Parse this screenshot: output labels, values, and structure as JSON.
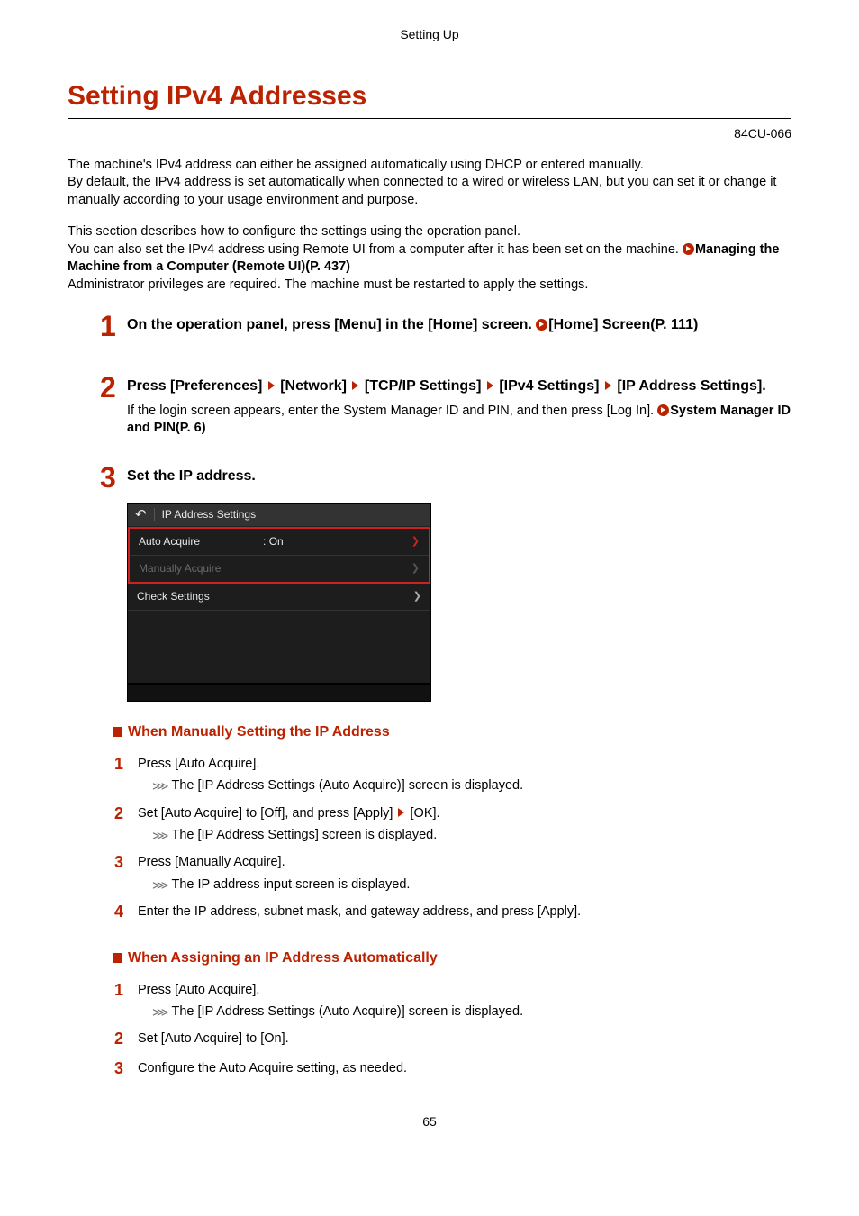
{
  "header": {
    "section": "Setting Up"
  },
  "title": "Setting IPv4 Addresses",
  "doc_code": "84CU-066",
  "intro": {
    "p1_l1": "The machine's IPv4 address can either be assigned automatically using DHCP or entered manually.",
    "p1_l2": "By default, the IPv4 address is set automatically when connected to a wired or wireless LAN, but you can set it or change it manually according to your usage environment and purpose.",
    "p2_l1": "This section describes how to configure the settings using the operation panel.",
    "p2_l2a": "You can also set the IPv4 address using Remote UI from a computer after it has been set on the machine. ",
    "p2_link": "Managing the Machine from a Computer (Remote UI)(P. 437)",
    "p2_l3": "Administrator privileges are required. The machine must be restarted to apply the settings."
  },
  "steps": {
    "s1": {
      "num": "1",
      "title_a": "On the operation panel, press [Menu] in the [Home] screen. ",
      "title_link": "[Home] Screen(P. 111)"
    },
    "s2": {
      "num": "2",
      "bc1": "Press [Preferences]",
      "bc2": "[Network]",
      "bc3": "[TCP/IP Settings]",
      "bc4": "[IPv4 Settings]",
      "bc5": "[IP Address Settings].",
      "desc_a": "If the login screen appears, enter the System Manager ID and PIN, and then press [Log In]. ",
      "desc_link": "System Manager ID and PIN(P. 6)"
    },
    "s3": {
      "num": "3",
      "title": "Set the IP address."
    }
  },
  "device": {
    "title": "IP Address Settings",
    "row1_label": "Auto Acquire",
    "row1_value": ": On",
    "row2_label": "Manually Acquire",
    "row3_label": "Check Settings"
  },
  "sub_a": {
    "heading": "When Manually Setting the IP Address",
    "s1": {
      "num": "1",
      "text": "Press [Auto Acquire].",
      "result": "The [IP Address Settings (Auto Acquire)] screen is displayed."
    },
    "s2": {
      "num": "2",
      "text_a": "Set [Auto Acquire] to [Off], and press [Apply] ",
      "text_b": " [OK].",
      "result": "The [IP Address Settings] screen is displayed."
    },
    "s3": {
      "num": "3",
      "text": "Press [Manually Acquire].",
      "result": "The IP address input screen is displayed."
    },
    "s4": {
      "num": "4",
      "text": "Enter the IP address, subnet mask, and gateway address, and press [Apply]."
    }
  },
  "sub_b": {
    "heading": "When Assigning an IP Address Automatically",
    "s1": {
      "num": "1",
      "text": "Press [Auto Acquire].",
      "result": "The [IP Address Settings (Auto Acquire)] screen is displayed."
    },
    "s2": {
      "num": "2",
      "text": "Set [Auto Acquire] to [On]."
    },
    "s3": {
      "num": "3",
      "text": "Configure the Auto Acquire setting, as needed."
    }
  },
  "page_number": "65"
}
